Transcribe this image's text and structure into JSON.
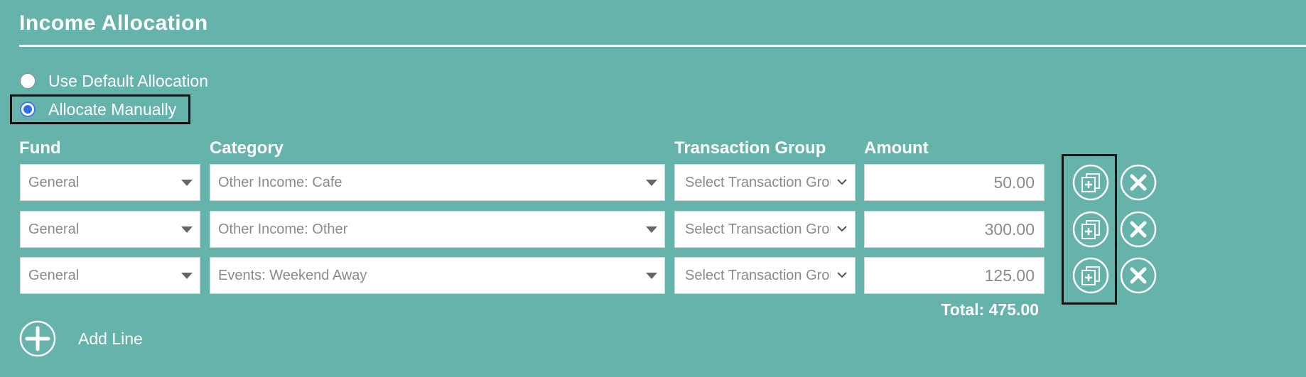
{
  "section": {
    "title": "Income Allocation"
  },
  "allocation_mode": {
    "options": [
      {
        "label": "Use Default Allocation",
        "selected": false
      },
      {
        "label": "Allocate Manually",
        "selected": true
      }
    ]
  },
  "table": {
    "headers": {
      "fund": "Fund",
      "category": "Category",
      "transaction_group": "Transaction Group",
      "amount": "Amount"
    },
    "rows": [
      {
        "fund": "General",
        "category": "Other Income: Cafe",
        "transaction_group": "Select Transaction Group",
        "amount": "50.00"
      },
      {
        "fund": "General",
        "category": "Other Income: Other",
        "transaction_group": "Select Transaction Group",
        "amount": "300.00"
      },
      {
        "fund": "General",
        "category": "Events: Weekend Away",
        "transaction_group": "Select Transaction Group",
        "amount": "125.00"
      }
    ],
    "total_label": "Total: 475.00"
  },
  "add_line": {
    "label": "Add Line"
  },
  "icons": {
    "duplicate": "duplicate-row-icon",
    "remove": "remove-row-icon",
    "add": "add-line-icon",
    "dropdown": "chevron-down-icon"
  },
  "colors": {
    "background": "#66b3ab",
    "foreground": "#ffffff",
    "radio_selected": "#2f6ee8",
    "highlight_border": "#111111"
  }
}
